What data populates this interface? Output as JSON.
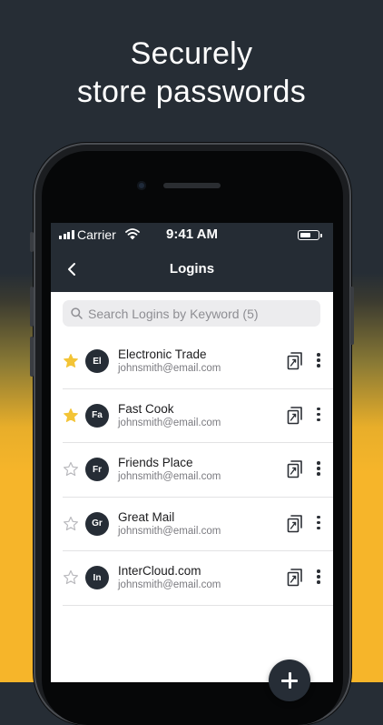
{
  "headline": {
    "line1": "Securely",
    "line2": "store passwords"
  },
  "status_bar": {
    "carrier": "Carrier",
    "time": "9:41 AM",
    "battery_level": 0.6
  },
  "nav": {
    "title": "Logins",
    "back_icon": "chevron-left-icon"
  },
  "search": {
    "placeholder": "Search Logins by Keyword (5)",
    "value": ""
  },
  "logins": [
    {
      "initials": "El",
      "name": "Electronic Trade",
      "email": "johnsmith@email.com",
      "favorite": true
    },
    {
      "initials": "Fa",
      "name": "Fast Cook",
      "email": "johnsmith@email.com",
      "favorite": true
    },
    {
      "initials": "Fr",
      "name": "Friends Place",
      "email": "johnsmith@email.com",
      "favorite": false
    },
    {
      "initials": "Gr",
      "name": "Great Mail",
      "email": "johnsmith@email.com",
      "favorite": false
    },
    {
      "initials": "In",
      "name": "InterCloud.com",
      "email": "johnsmith@email.com",
      "favorite": false
    }
  ],
  "icons": {
    "favorite": "star-filled-icon",
    "not_favorite": "star-outline-icon",
    "copy": "copy-icon",
    "more": "more-vertical-icon",
    "add": "plus-icon"
  },
  "colors": {
    "header_bg": "#252c34",
    "accent_yellow": "#f6b52a",
    "star_filled": "#f3c436",
    "avatar_bg": "#262d36"
  }
}
